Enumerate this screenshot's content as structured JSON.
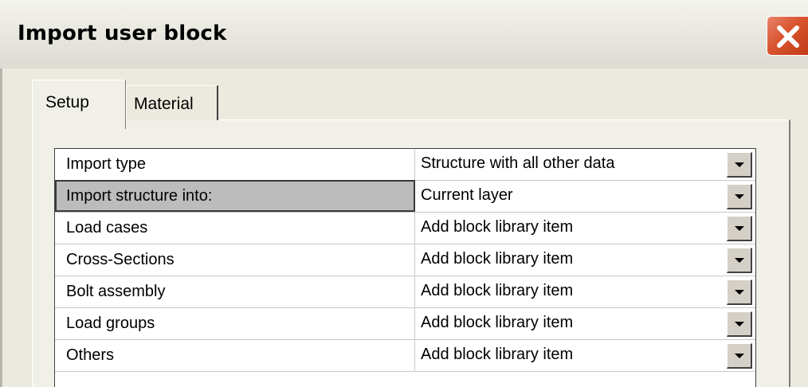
{
  "window": {
    "title": "Import user block"
  },
  "tabs": [
    {
      "label": "Setup",
      "active": true
    },
    {
      "label": "Material",
      "active": false
    }
  ],
  "properties": {
    "rows": [
      {
        "label": "Import type",
        "value": "Structure with all other data"
      },
      {
        "label": "Import structure into:",
        "value": "Current layer",
        "selected": true
      },
      {
        "label": "Load cases",
        "value": "Add block library item"
      },
      {
        "label": "Cross-Sections",
        "value": "Add block library item"
      },
      {
        "label": "Bolt assembly",
        "value": "Add block library item"
      },
      {
        "label": "Load groups",
        "value": "Add block library item"
      },
      {
        "label": "Others",
        "value": "Add block library item"
      }
    ]
  },
  "icons": {
    "close": "close-icon",
    "dropdown": "chevron-down-icon"
  },
  "colors": {
    "close_button": "#d9542f",
    "titlebar": "#ebeae2",
    "dialog_face": "#eceade",
    "selected_cell": "#bcbcbc"
  }
}
